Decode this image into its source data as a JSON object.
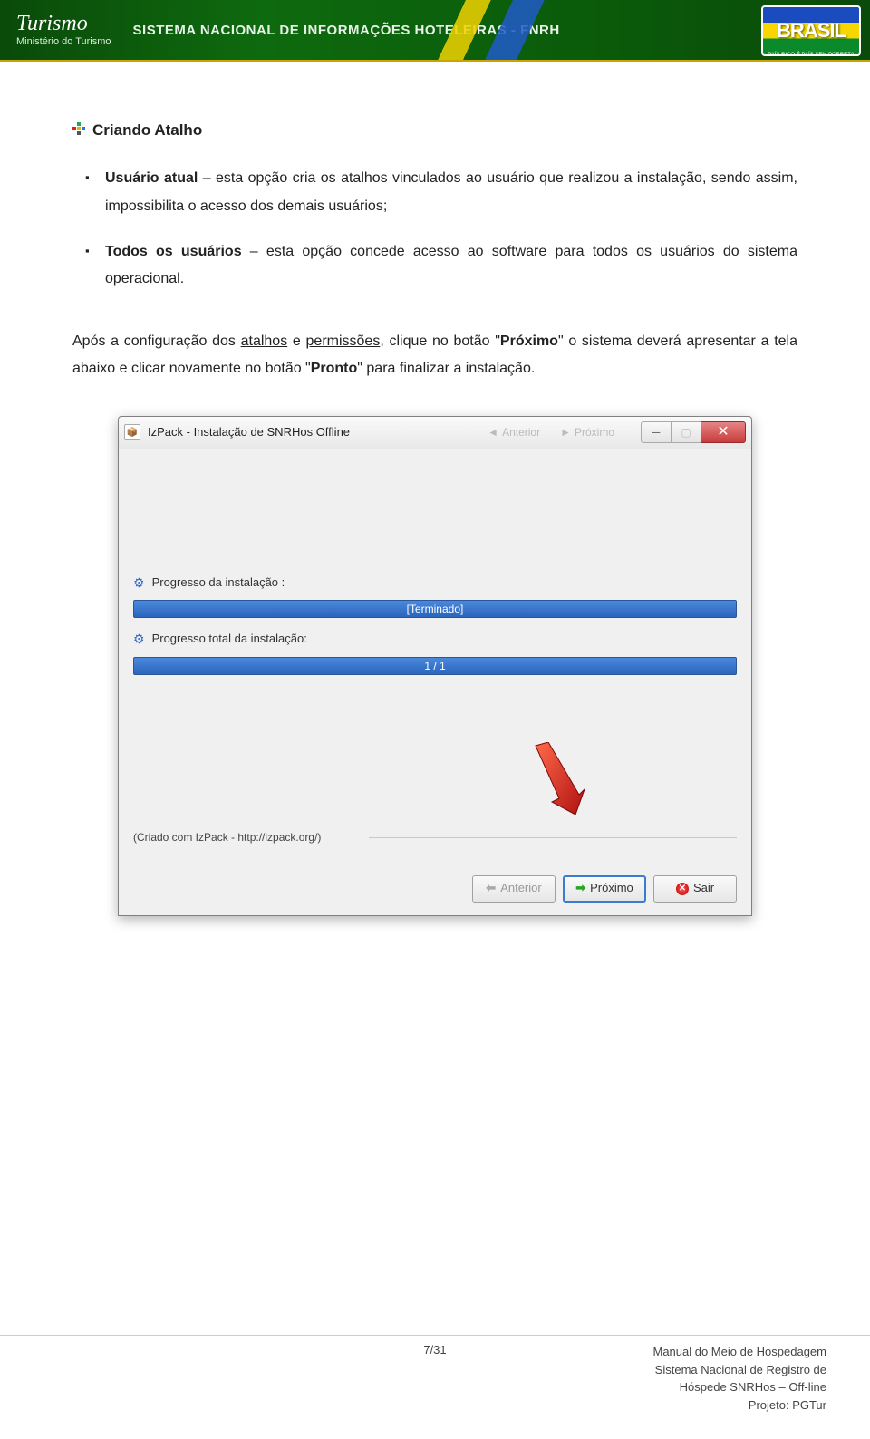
{
  "banner": {
    "title": "Turismo",
    "subtitle": "Ministério do Turismo",
    "center": "SISTEMA NACIONAL DE INFORMAÇÕES HOTELEIRAS - FNRH",
    "logo_text": "BRASIL",
    "logo_tag": "PAÍS RICO É PAÍS SEM POBREZA"
  },
  "heading": "Criando Atalho",
  "bullets": [
    {
      "label": "Usuário atual",
      "text": " – esta opção cria os atalhos vinculados ao usuário que realizou a instalação, sendo assim, impossibilita o acesso dos demais usuários;"
    },
    {
      "label": "Todos os usuários",
      "text": " – esta opção concede acesso ao software para todos os usuários do sistema operacional."
    }
  ],
  "paragraph": {
    "p1": "Após a configuração dos ",
    "u1": "atalhos",
    "p2": " e ",
    "u2": "permissões",
    "p3": ", clique no botão \"",
    "b1": "Próximo",
    "p4": "\" o sistema deverá apresentar a tela abaixo e clicar novamente no botão \"",
    "b2": "Pronto",
    "p5": "\" para finalizar a instalação."
  },
  "installer": {
    "window_title": "IzPack - Instalação de SNRHos Offline",
    "disabled1": "Anterior",
    "disabled2": "Próximo",
    "progress_label": "Progresso da instalação :",
    "progress_status": "[Terminado]",
    "total_label": "Progresso total da instalação:",
    "total_status": "1 / 1",
    "credit": "(Criado com IzPack - http://izpack.org/)",
    "btn_prev": "Anterior",
    "btn_next": "Próximo",
    "btn_exit": "Sair"
  },
  "footer": {
    "page": "7/31",
    "line1": "Manual do Meio de Hospedagem",
    "line2": "Sistema Nacional de Registro de",
    "line3": "Hóspede  SNRHos – Off-line",
    "line4": "Projeto: PGTur"
  }
}
